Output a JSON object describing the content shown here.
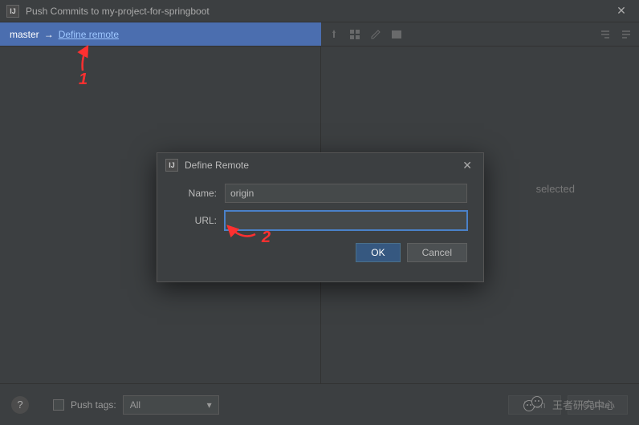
{
  "titlebar": {
    "title": "Push Commits to my-project-for-springboot"
  },
  "branch": {
    "local": "master",
    "define_remote_label": "Define remote"
  },
  "right_pane": {
    "no_commits": "selected"
  },
  "annotations": {
    "one": "1",
    "two": "2"
  },
  "modal": {
    "title": "Define Remote",
    "name_label": "Name:",
    "name_value": "origin",
    "url_label": "URL:",
    "url_value": "",
    "ok": "OK",
    "cancel": "Cancel"
  },
  "footer": {
    "push_tags_label": "Push tags:",
    "combo_value": "All",
    "push_btn": "Push",
    "cancel_btn": "Cancel"
  },
  "watermark": {
    "text": "王者研究中心"
  }
}
